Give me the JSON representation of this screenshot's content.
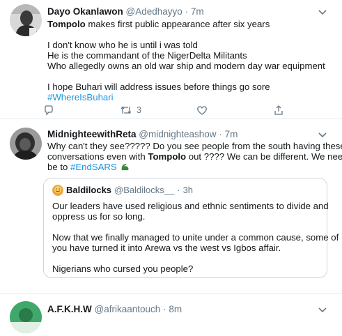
{
  "tweets": [
    {
      "name": "Dayo Okanlawon",
      "handle": "@Adedhayyo",
      "sep": "·",
      "time": "7m",
      "line1_bold": "Tompolo",
      "line1_rest": " makes first public appearance after six years",
      "line2": "I don't know who he is until i was told",
      "line3": "He is the commandant of the NigerDelta Militants",
      "line4": "Who allegedly owns an old war ship and modern day war equipment",
      "line5": "I hope Buhari will address issues before things go sore",
      "hashtag": "#WhereIsBuhari",
      "retweets": "3"
    },
    {
      "name": "MidnighteewithReta",
      "handle": "@midnighteashow",
      "sep": "·",
      "time": "7m",
      "line1": "Why can't they see????? Do you see people from the south having these",
      "line2_pre": "conversations even with ",
      "line2_bold": "Tompolo",
      "line2_post": " out ???? We can be different. We need to",
      "line3_pre": "be to ",
      "hashtag": "#EndSARS",
      "emoji": "flexed-arm-emoji",
      "quote": {
        "name": "Baldilocks",
        "handle": "@Baldilocks__",
        "sep": "·",
        "time": "3h",
        "line1": "Our leaders have used religious and ethnic sentiments to divide and",
        "line2": "oppress us for so long.",
        "line3": "Now that we finally managed to unite under a common cause, some of",
        "line4": "you have turned it into Arewa vs the west vs Igbos affair.",
        "line5": "Nigerians who cursed you people?"
      }
    },
    {
      "name": "A.F.K.H.W",
      "handle": "@afrikaantouch",
      "sep": "·",
      "time": "8m"
    }
  ],
  "colors": {
    "link": "#1b95e0",
    "muted": "#657786",
    "border": "#e6ecf0"
  }
}
